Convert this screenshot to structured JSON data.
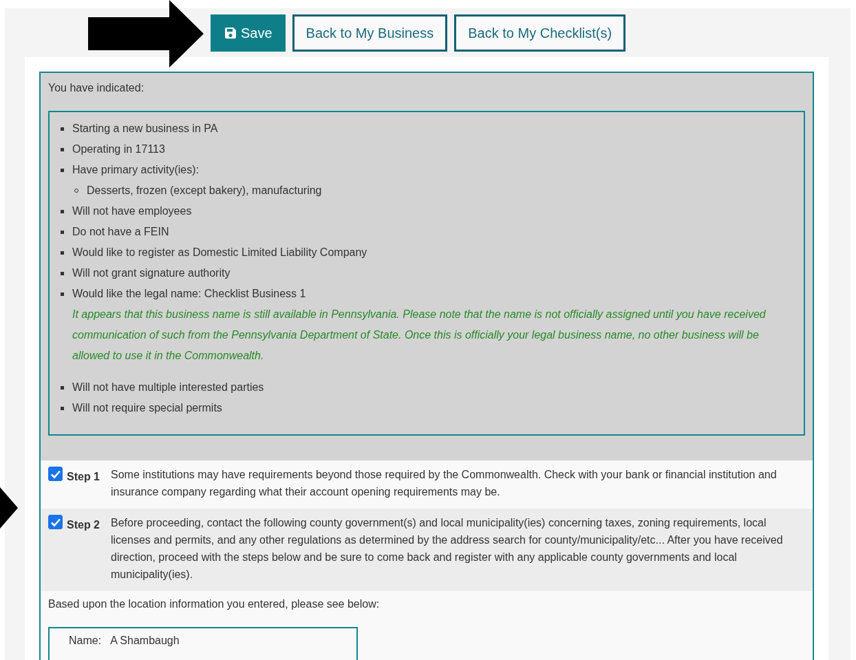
{
  "toolbar": {
    "buttons": [
      {
        "label": "Save",
        "kind": "primary"
      },
      {
        "label": "Back to My Business",
        "kind": "outline"
      },
      {
        "label": "Back to My Checklist(s)",
        "kind": "outline"
      }
    ]
  },
  "summary": {
    "intro": "You have indicated:",
    "items": [
      {
        "text": "Starting a new business in PA"
      },
      {
        "text": "Operating in 17113"
      },
      {
        "text": "Have primary activity(ies):",
        "children": [
          {
            "text": "Desserts, frozen (except bakery), manufacturing"
          }
        ]
      },
      {
        "text": "Will not have employees"
      },
      {
        "text": "Do not have a FEIN"
      },
      {
        "text": "Would like to register as Domestic Limited Liability Company"
      },
      {
        "text": "Will not grant signature authority"
      },
      {
        "text": "Would like the legal name: Checklist Business 1",
        "note": "It appears that this business name is still available in Pennsylvania. Please note that the name is not officially assigned until you have received communication of such from the Pennsylvania Department of State. Once this is officially your legal business name, no other business will be allowed to use it in the Commonwealth."
      },
      {
        "text": "Will not have multiple interested parties"
      },
      {
        "text": "Will not require special permits"
      }
    ]
  },
  "steps": [
    {
      "label": "Step 1",
      "checked": true,
      "text": "Some institutions may have requirements beyond those required by the Commonwealth. Check with your bank or financial institution and insurance company regarding what their account opening requirements may be."
    },
    {
      "label": "Step 2",
      "checked": true,
      "text": "Before proceeding, contact the following county government(s) and local municipality(ies) concerning taxes, zoning requirements, local licenses and permits, and any other regulations as determined by the address search for county/municipality/etc... After you have received direction, proceed with the steps below and be sure to come back and register with any applicable county governments and local municipality(ies)."
    }
  ],
  "location": {
    "intro": "Based upon the location information you entered, please see below:",
    "fields": [
      {
        "label": "Name:",
        "value": "A Shambaugh"
      }
    ]
  }
}
